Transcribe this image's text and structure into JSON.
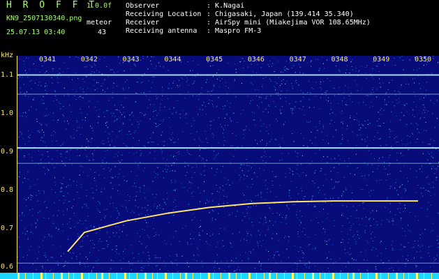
{
  "header": {
    "app_title": "H R O F F T",
    "version": "1.0.0f",
    "filename": "KN9_2507130340.png",
    "mode": "meteor",
    "timestamp": "25.07.13 03:40",
    "count": "43",
    "observer": {
      "label": "Observer",
      "value": ": K.Nagai"
    },
    "location": {
      "label": "Receiving Location",
      "value": ": Chigasaki, Japan (139.414 35.340)"
    },
    "receiver": {
      "label": "Receiver",
      "value": ": AirSpy mini (Miakejima VOR 108.65MHz)"
    },
    "antenna": {
      "label": "Receiving antenna",
      "value": ": Maspro FM-3"
    }
  },
  "axis": {
    "y_unit": "kHz",
    "y_ticks": [
      "1.1",
      "1.0",
      "0.9",
      "0.8",
      "0.7",
      "0.6"
    ],
    "x_ticks": [
      "0341",
      "0342",
      "0343",
      "0344",
      "0345",
      "0346",
      "0347",
      "0348",
      "0349",
      "0350"
    ]
  },
  "colors": {
    "background": "#070c7a",
    "noise_dots": "#6fd0ff",
    "trace": "#ffe36a",
    "bottom_bar": "#1fd8ff",
    "axis_text": "#ffe86a",
    "header_green": "#a8ff6f"
  },
  "spectrogram": {
    "y_range_khz": [
      0.6,
      1.1
    ],
    "horizontal_lines_khz": [
      1.1,
      1.05,
      0.91,
      0.87,
      0.61
    ],
    "meteor_trace": [
      {
        "t": "0341",
        "khz": 0.64
      },
      {
        "t": "0342",
        "khz": 0.69
      },
      {
        "t": "0343",
        "khz": 0.72
      },
      {
        "t": "0344",
        "khz": 0.74
      },
      {
        "t": "0345",
        "khz": 0.755
      },
      {
        "t": "0346",
        "khz": 0.765
      },
      {
        "t": "0347",
        "khz": 0.77
      },
      {
        "t": "0348",
        "khz": 0.772
      },
      {
        "t": "0349",
        "khz": 0.772
      },
      {
        "t": "0350",
        "khz": 0.772
      }
    ]
  }
}
